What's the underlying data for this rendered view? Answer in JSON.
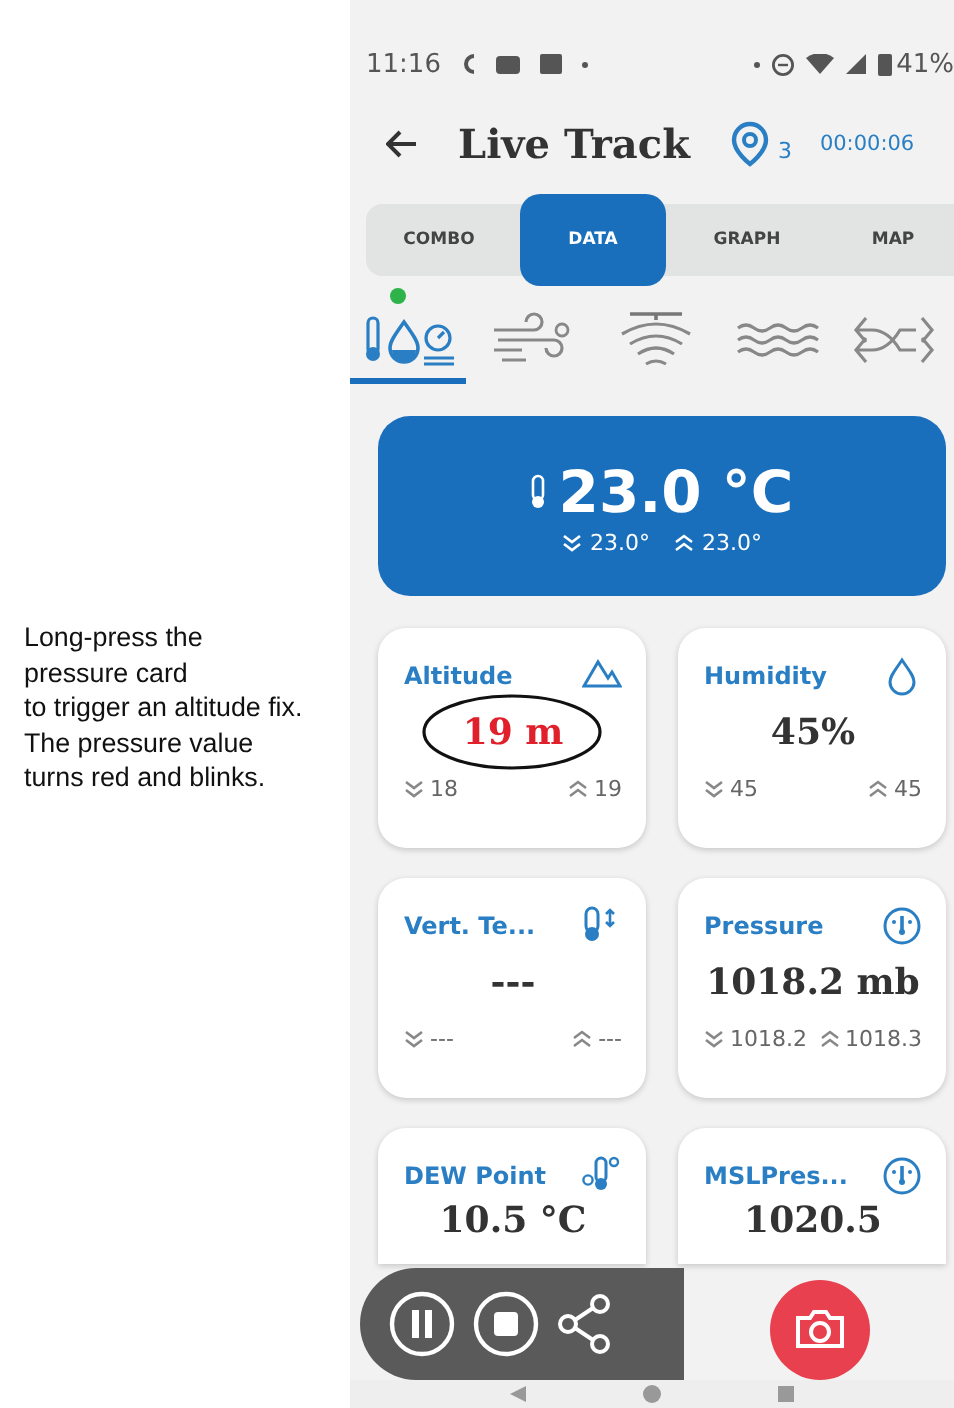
{
  "annotation": {
    "text": "Long-press the\npressure card\nto trigger an altitude fix.\nThe pressure value\nturns red and blinks."
  },
  "status_bar": {
    "time": "11:16",
    "battery": "41%"
  },
  "header": {
    "title": "Live Track",
    "satellites": "3",
    "timer": "00:00:06"
  },
  "tabs": [
    {
      "label": "COMBO",
      "selected": false
    },
    {
      "label": "DATA",
      "selected": true
    },
    {
      "label": "GRAPH",
      "selected": false
    },
    {
      "label": "MAP",
      "selected": false
    }
  ],
  "sensor_groups": [
    {
      "kind": "climate",
      "selected": true,
      "indicator": true
    },
    {
      "kind": "wind",
      "selected": false,
      "indicator": false
    },
    {
      "kind": "signal",
      "selected": false,
      "indicator": false
    },
    {
      "kind": "waves",
      "selected": false,
      "indicator": false
    },
    {
      "kind": "shuffle",
      "selected": false,
      "indicator": false
    }
  ],
  "hero": {
    "value": "23.0 °C",
    "min": "23.0°",
    "max": "23.0°"
  },
  "cards": [
    {
      "kind": "altitude",
      "title": "Altitude",
      "value": "19 m",
      "alert": true,
      "circled": true,
      "min": "18",
      "max": "19"
    },
    {
      "kind": "humidity",
      "title": "Humidity",
      "value": "45%",
      "alert": false,
      "circled": false,
      "min": "45",
      "max": "45"
    },
    {
      "kind": "vertical",
      "title": "Vert. Te...",
      "value": "---",
      "alert": false,
      "circled": false,
      "min": "---",
      "max": "---"
    },
    {
      "kind": "pressure",
      "title": "Pressure",
      "value": "1018.2 mb",
      "alert": false,
      "circled": false,
      "min": "1018.2",
      "max": "1018.3"
    },
    {
      "kind": "dew",
      "title": "DEW Point",
      "value": "10.5 °C",
      "alert": false,
      "circled": false
    },
    {
      "kind": "pressure",
      "title": "MSLPres...",
      "value": "1020.5",
      "alert": false,
      "circled": false
    }
  ],
  "controls": [
    {
      "kind": "pause"
    },
    {
      "kind": "stop"
    },
    {
      "kind": "share"
    },
    {
      "kind": "camera"
    }
  ]
}
